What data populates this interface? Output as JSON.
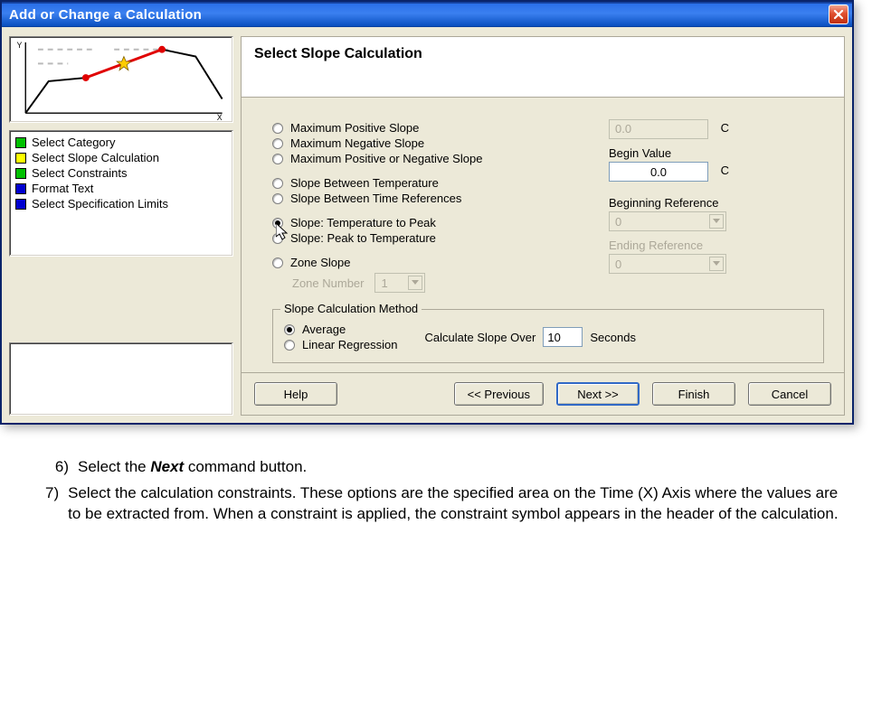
{
  "title": "Add or Change a Calculation",
  "preview": {
    "x_label": "X",
    "y_label": "Y"
  },
  "steps": [
    {
      "label": "Select Category",
      "color": "#00c000"
    },
    {
      "label": "Select Slope Calculation",
      "color": "#ffff00"
    },
    {
      "label": "Select Constraints",
      "color": "#00c000"
    },
    {
      "label": "Format Text",
      "color": "#0000d0"
    },
    {
      "label": "Select Specification Limits",
      "color": "#0000d0"
    }
  ],
  "header": {
    "title": "Select Slope Calculation"
  },
  "slope_options": {
    "group1": [
      "Maximum Positive Slope",
      "Maximum Negative Slope",
      "Maximum Positive or Negative Slope"
    ],
    "group2": [
      "Slope Between Temperature",
      "Slope Between Time References"
    ],
    "group3": [
      "Slope: Temperature to Peak",
      "Slope: Peak to Temperature"
    ],
    "group4": [
      "Zone Slope"
    ],
    "selected": "Slope: Temperature to Peak"
  },
  "zone": {
    "label": "Zone Number",
    "value": "1"
  },
  "right_fields": {
    "top_value": "0.0",
    "top_unit": "C",
    "begin_label": "Begin Value",
    "begin_value": "0.0",
    "begin_unit": "C",
    "beginning_ref_label": "Beginning Reference",
    "beginning_ref_value": "0",
    "ending_ref_label": "Ending Reference",
    "ending_ref_value": "0"
  },
  "method": {
    "legend": "Slope Calculation Method",
    "options": [
      "Average",
      "Linear Regression"
    ],
    "selected": "Average",
    "calc_label_pre": "Calculate Slope Over",
    "calc_value": "10",
    "calc_label_post": "Seconds"
  },
  "buttons": {
    "help": "Help",
    "prev": "<< Previous",
    "next": "Next >>",
    "finish": "Finish",
    "cancel": "Cancel"
  },
  "instructions": {
    "items": [
      {
        "num": "6)",
        "pre": "Select the ",
        "bold": "Next",
        "post": " command button."
      },
      {
        "num": "7)",
        "pre": "Select the calculation constraints. These options are the specified area on the Time (X) Axis where the values are to be extracted from.   When a constraint is applied, the constraint symbol appears in the header of the calculation.",
        "bold": "",
        "post": ""
      }
    ]
  }
}
